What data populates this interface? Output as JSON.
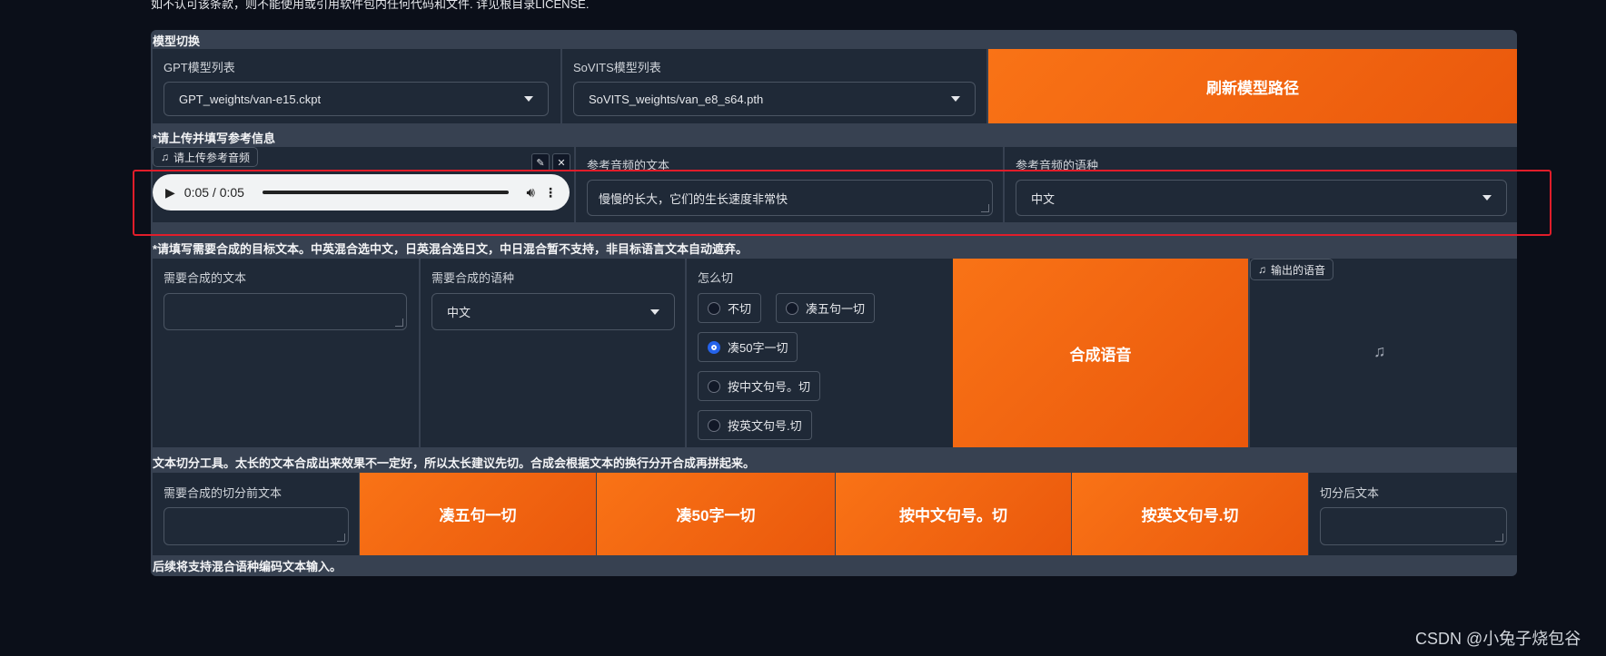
{
  "notice": "如不认可该条款，则不能使用或引用软件包内任何代码和文件. 详见根目录LICENSE.",
  "model_switch": {
    "title": "模型切换",
    "gpt_label": "GPT模型列表",
    "gpt_value": "GPT_weights/van-e15.ckpt",
    "sovits_label": "SoVITS模型列表",
    "sovits_value": "SoVITS_weights/van_e8_s64.pth",
    "refresh_label": "刷新模型路径"
  },
  "reference": {
    "title": "*请上传并填写参考信息",
    "upload_badge": "请上传参考音频",
    "player_time": "0:05 / 0:05",
    "ref_text_label": "参考音频的文本",
    "ref_text_value": "慢慢的长大，它们的生长速度非常快",
    "ref_lang_label": "参考音频的语种",
    "ref_lang_value": "中文"
  },
  "synthesis": {
    "title": "*请填写需要合成的目标文本。中英混合选中文，日英混合选日文，中日混合暂不支持，非目标语言文本自动遮弃。",
    "text_label": "需要合成的文本",
    "lang_label": "需要合成的语种",
    "lang_value": "中文",
    "cut_label": "怎么切",
    "cut_options": [
      "不切",
      "凑五句一切",
      "凑50字一切",
      "按中文句号。切",
      "按英文句号.切"
    ],
    "cut_selected": "凑50字一切",
    "synth_button": "合成语音",
    "output_badge": "输出的语音"
  },
  "split_tool": {
    "title": "文本切分工具。太长的文本合成出来效果不一定好，所以太长建议先切。合成会根据文本的换行分开合成再拼起来。",
    "input_label": "需要合成的切分前文本",
    "buttons": [
      "凑五句一切",
      "凑50字一切",
      "按中文句号。切",
      "按英文句号.切"
    ],
    "output_label": "切分后文本"
  },
  "footer_note": "后续将支持混合语种编码文本输入。",
  "watermark": "CSDN @小兔子烧包谷",
  "colors": {
    "background": "#0b0f19",
    "panel": "#1f2937",
    "accent_orange": "#f97316",
    "highlight_red": "#e11d2a",
    "radio_selected": "#2563eb"
  }
}
